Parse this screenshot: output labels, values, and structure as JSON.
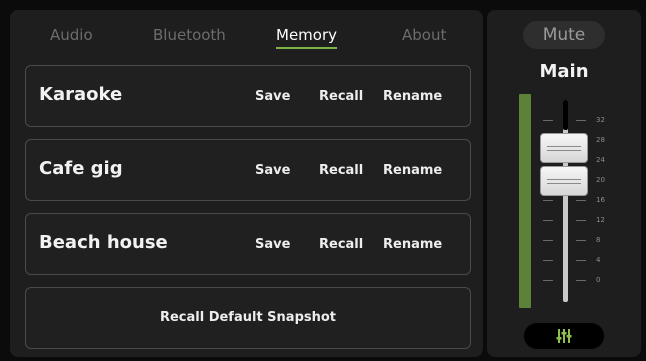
{
  "tabs": [
    {
      "label": "Audio"
    },
    {
      "label": "Bluetooth"
    },
    {
      "label": "Memory"
    },
    {
      "label": "About"
    }
  ],
  "active_tab": "Memory",
  "snapshots": [
    {
      "name": "Karaoke",
      "save": "Save",
      "recall": "Recall",
      "rename": "Rename"
    },
    {
      "name": "Cafe gig",
      "save": "Save",
      "recall": "Recall",
      "rename": "Rename"
    },
    {
      "name": "Beach house",
      "save": "Save",
      "recall": "Recall",
      "rename": "Rename"
    }
  ],
  "default_snapshot": {
    "label": "Recall Default Snapshot"
  },
  "mixer": {
    "mute_label": "Mute",
    "channel_label": "Main",
    "scale": [
      "32",
      "28",
      "24",
      "20",
      "16",
      "12",
      "8",
      "4",
      "0"
    ],
    "eq_icon": "sliders-icon"
  },
  "colors": {
    "accent": "#7fb24a",
    "meter": "#5b8238",
    "eq_icon": "#8fc04f"
  }
}
